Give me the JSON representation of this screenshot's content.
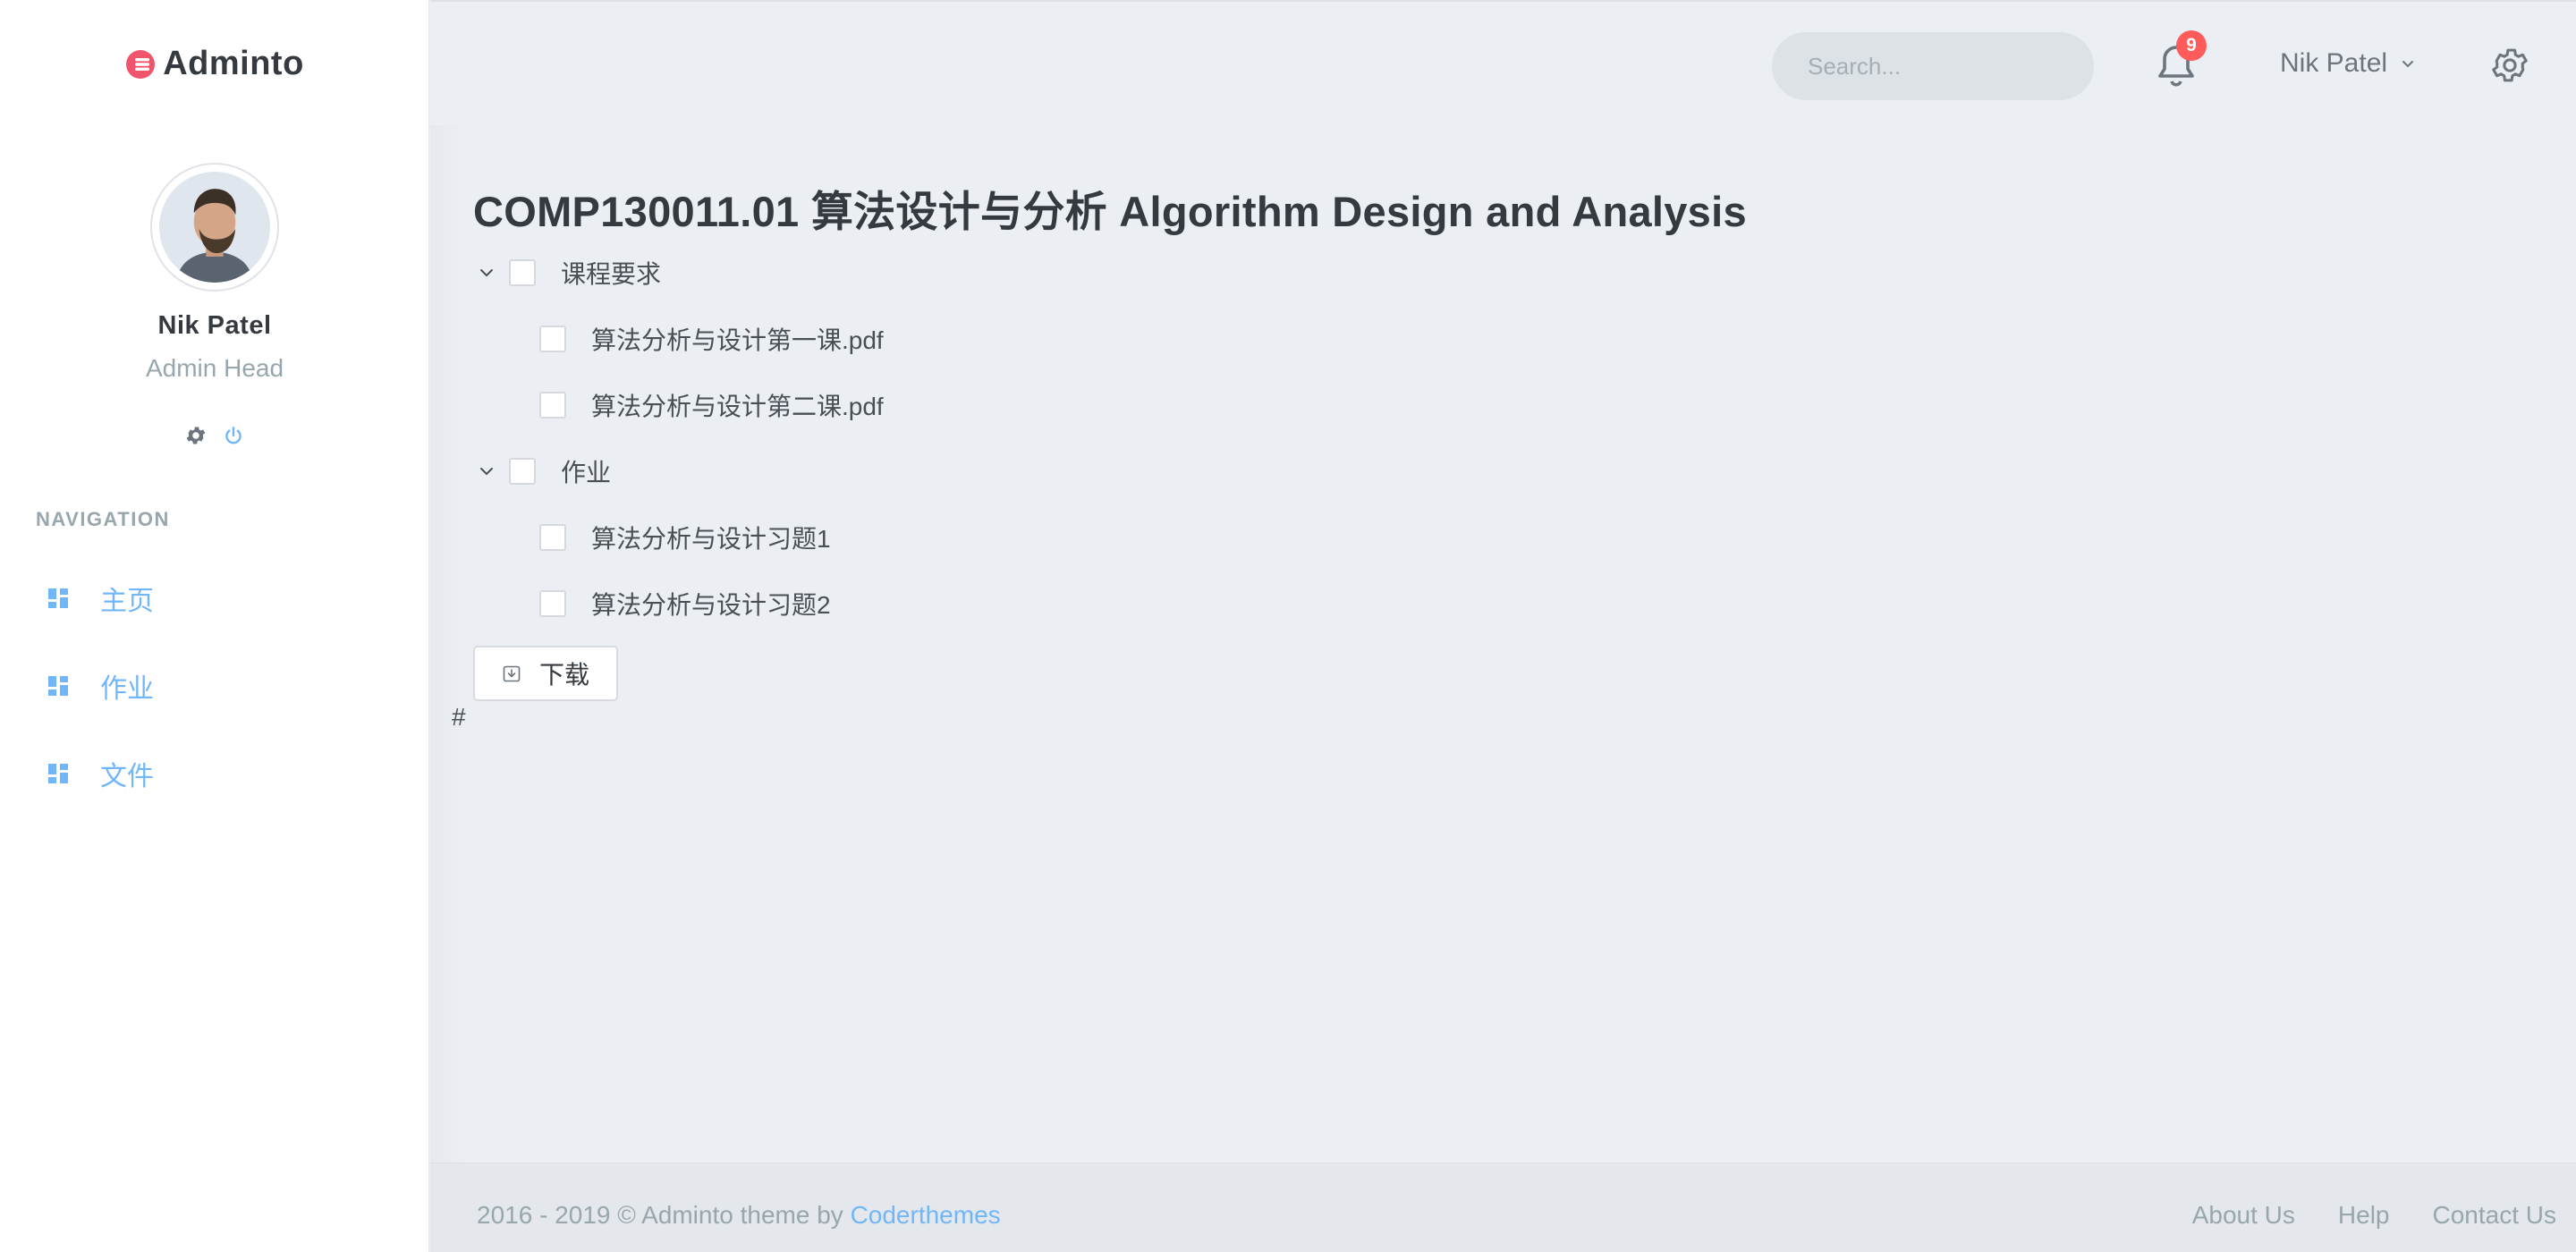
{
  "app": {
    "name": "Adminto",
    "accent_color": "#71b6f9",
    "danger_color": "#ff5b5b"
  },
  "sidebar": {
    "user": {
      "name": "Nik Patel",
      "role": "Admin Head"
    },
    "user_actions": [
      "gear-icon",
      "power-icon"
    ],
    "nav_title": "NAVIGATION",
    "items": [
      {
        "label": "主页",
        "icon": "dashboard-icon"
      },
      {
        "label": "作业",
        "icon": "dashboard-icon"
      },
      {
        "label": "文件",
        "icon": "dashboard-icon"
      }
    ]
  },
  "topbar": {
    "search": {
      "placeholder": "Search...",
      "value": ""
    },
    "notifications": {
      "count": "9"
    },
    "user_menu": {
      "name": "Nik Patel"
    }
  },
  "main": {
    "title": "COMP130011.01 算法设计与分析 Algorithm Design and Analysis",
    "tree": [
      {
        "label": "课程要求",
        "expanded": true,
        "checked": false,
        "children": [
          {
            "label": "算法分析与设计第一课.pdf",
            "checked": false
          },
          {
            "label": "算法分析与设计第二课.pdf",
            "checked": false
          }
        ]
      },
      {
        "label": "作业",
        "expanded": true,
        "checked": false,
        "children": [
          {
            "label": "算法分析与设计习题1",
            "checked": false
          },
          {
            "label": "算法分析与设计习题2",
            "checked": false
          }
        ]
      }
    ],
    "download_label": "下载",
    "hash_text": "#"
  },
  "footer": {
    "copyright": "2016 - 2019 © Adminto theme by ",
    "brand_link": "Coderthemes",
    "links": [
      "About Us",
      "Help",
      "Contact Us"
    ]
  }
}
